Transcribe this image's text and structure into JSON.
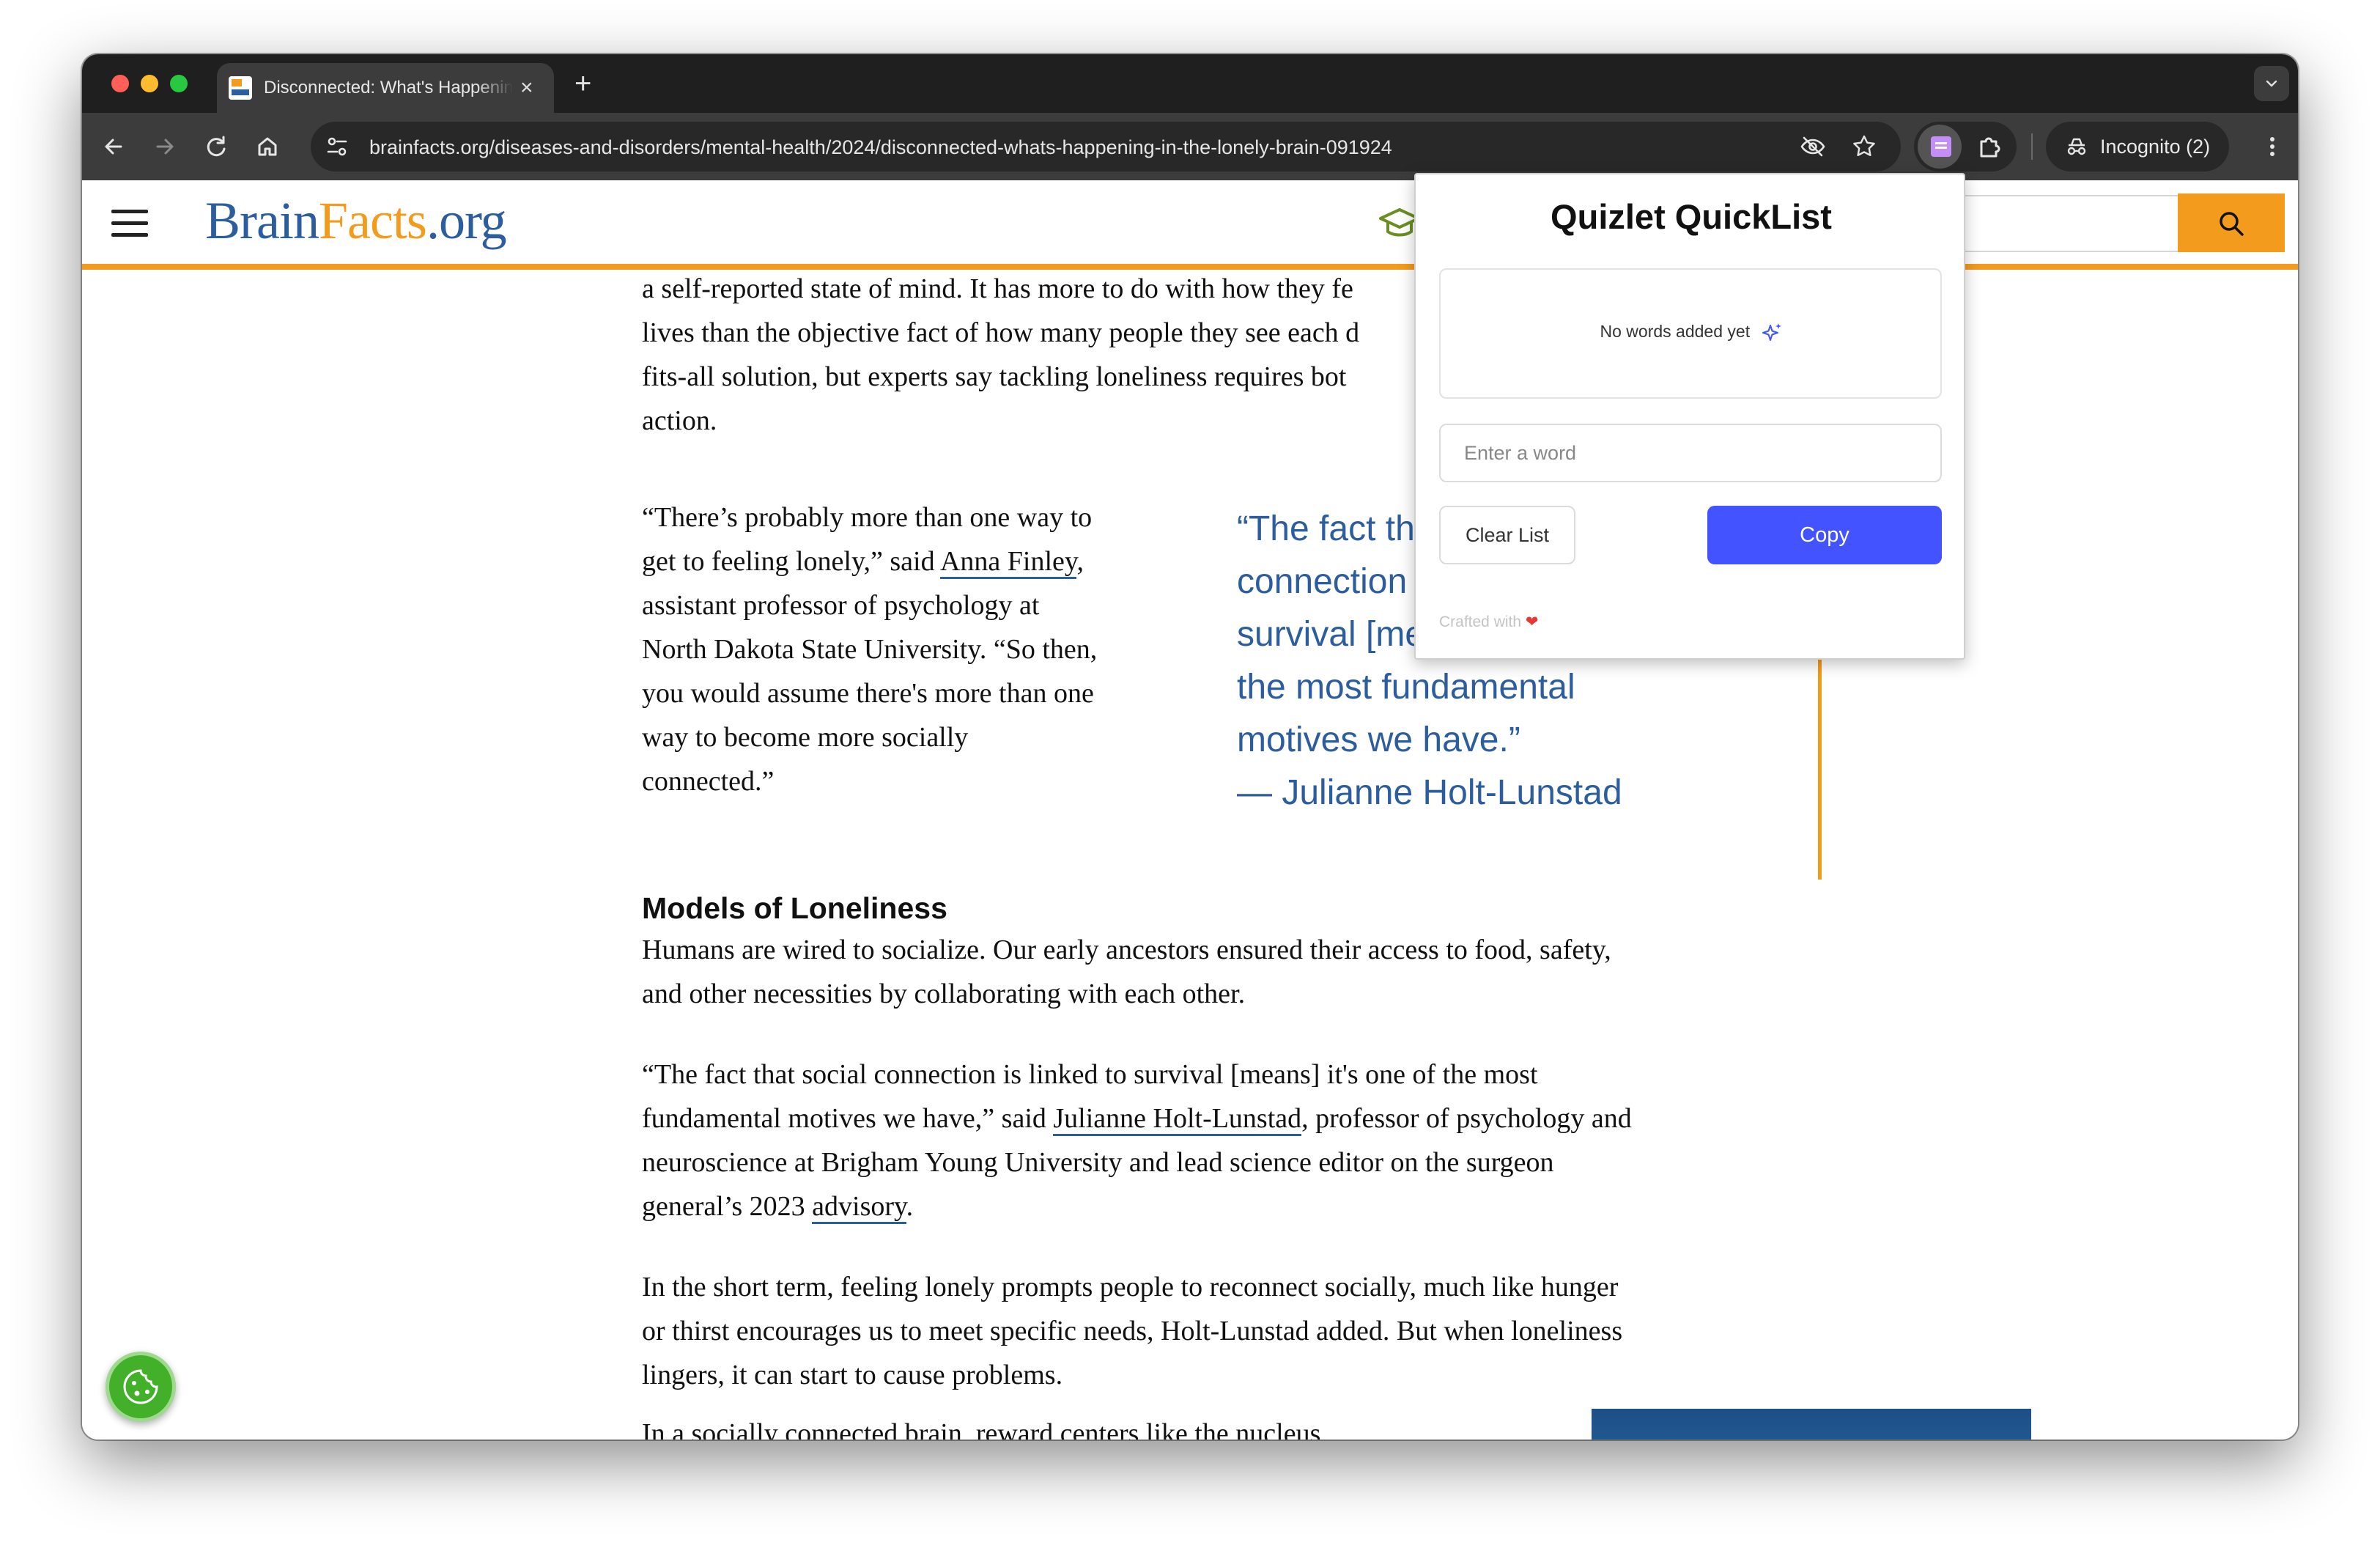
{
  "browser": {
    "tab_title": "Disconnected: What's Happening in the Lonely Brain",
    "tab_close": "×",
    "new_tab": "+",
    "url": "brainfacts.org/diseases-and-disorders/mental-health/2024/disconnected-whats-happening-in-the-lonely-brain-091924",
    "incognito_label": "Incognito (2)"
  },
  "site": {
    "logo_brain": "Brain",
    "logo_facts": "Facts",
    "logo_org": ".org"
  },
  "article": {
    "intro_lines": [
      "a self-reported state of mind. It has more to do with how they fe",
      "lives than the objective fact of how many people they see each d",
      "fits-all solution, but experts say tackling loneliness requires bot",
      "action."
    ],
    "finley_para": {
      "line1": "“There’s probably more than one way to",
      "line2_pre": "get to feeling lonely,” said ",
      "line2_link": "Anna Finley",
      "line2_post": ",",
      "line3": "assistant professor of psychology at",
      "line4": "North Dakota State University. “So then,",
      "line5": "you would assume there's more than one",
      "line6": "way to become more socially",
      "line7": "connected.”"
    },
    "pull_quote_lines": [
      "“The fact th",
      "connection",
      "survival [me",
      "the most fundamental",
      "motives we have.”",
      "— Julianne Holt-Lunstad"
    ],
    "section_heading": "Models of Loneliness",
    "humans_para": [
      "Humans are wired to socialize. Our early ancestors ensured their access to food, safety,",
      "and other necessities by collaborating with each other."
    ],
    "holt_para": {
      "line1": "“The fact that social connection is linked to survival [means] it's one of the most",
      "line2_pre": "fundamental motives we have,” said ",
      "line2_link": "Julianne Holt-Lunstad",
      "line2_post": ", professor of psychology and",
      "line3": "neuroscience at Brigham Young University and lead science editor on the surgeon",
      "line4_pre": "general’s 2023 ",
      "line4_link": "advisory",
      "line4_post": "."
    },
    "short_term_para": [
      "In the short term, feeling lonely prompts people to reconnect socially, much like hunger",
      "or thirst encourages us to meet specific needs, Holt-Lunstad added. But when loneliness",
      "lingers, it can start to cause problems."
    ],
    "last_line": "In a socially connected brain, reward centers like the nucleus"
  },
  "popup": {
    "title": "Quizlet QuickList",
    "empty_text": "No words added yet",
    "input_placeholder": "Enter a word",
    "clear_label": "Clear List",
    "copy_label": "Copy",
    "footer_text": "Crafted with",
    "footer_heart": "❤"
  },
  "colors": {
    "brand_blue": "#2c5d9e",
    "brand_orange": "#f39b1c",
    "copy_button": "#4253ff",
    "cookie_green": "#43b02a"
  }
}
